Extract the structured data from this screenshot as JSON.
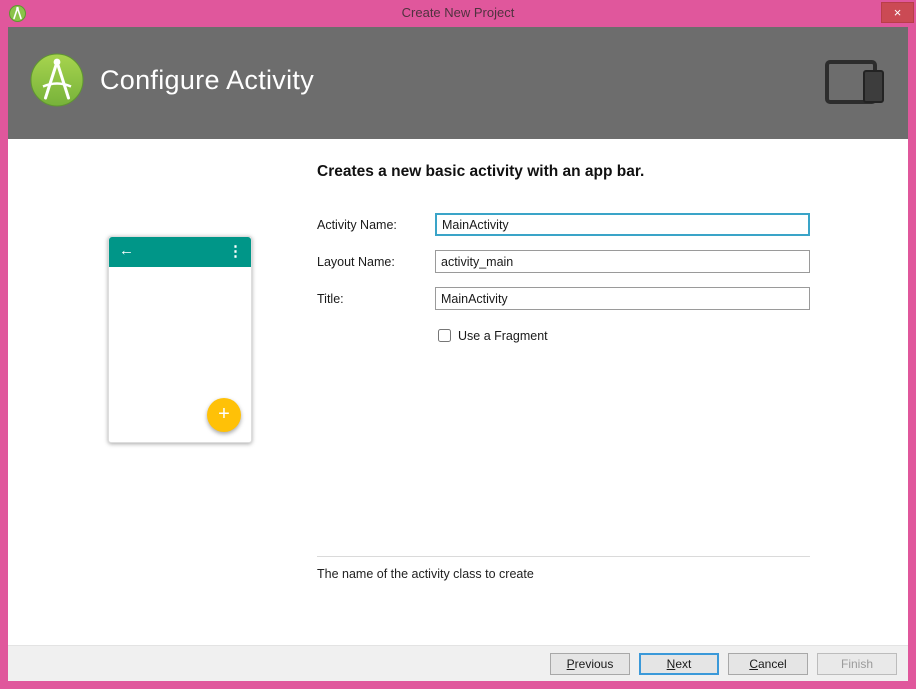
{
  "window": {
    "title": "Create New Project",
    "close_glyph": "×"
  },
  "header": {
    "title": "Configure Activity"
  },
  "main": {
    "heading": "Creates a new basic activity with an app bar.",
    "fields": [
      {
        "label": "Activity Name:",
        "value": "MainActivity"
      },
      {
        "label": "Layout Name:",
        "value": "activity_main"
      },
      {
        "label": "Title:",
        "value": "MainActivity"
      }
    ],
    "fragment_checkbox": {
      "label": "Use a Fragment",
      "checked": false
    },
    "hint": "The name of the activity class to create"
  },
  "preview": {
    "back_icon": "←",
    "menu_icon": "⋮",
    "fab_icon": "+"
  },
  "footer": {
    "buttons": [
      {
        "mnemonic": "P",
        "rest": "revious",
        "enabled": true
      },
      {
        "mnemonic": "N",
        "rest": "ext",
        "enabled": true,
        "default": true
      },
      {
        "mnemonic": "C",
        "rest": "ancel",
        "enabled": true
      },
      {
        "mnemonic": "",
        "rest": "Finish",
        "enabled": false
      }
    ]
  },
  "colors": {
    "accent_pink": "#e0579c",
    "close_red": "#cb4a54",
    "header_gray": "#6d6d6d",
    "toolbar_teal": "#009688",
    "fab_amber": "#ffc107",
    "focus_border": "#3aa4c8",
    "default_button_border": "#3b99d9"
  }
}
